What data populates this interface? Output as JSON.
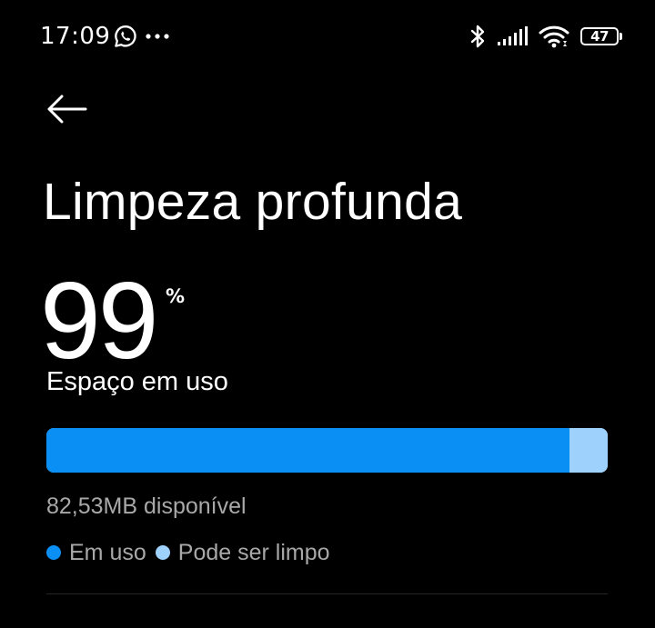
{
  "status_bar": {
    "time": "17:09",
    "notification_icons": [
      "whatsapp-icon",
      "more-dots-icon"
    ],
    "system_icons": [
      "bluetooth-icon",
      "signal-icon",
      "wifi-icon",
      "battery-icon"
    ],
    "battery_level": "47"
  },
  "header": {
    "back_icon": "back-arrow-icon",
    "title": "Limpeza profunda"
  },
  "usage": {
    "value": "99",
    "unit": "%",
    "label": "Espaço em uso",
    "used_fraction": 0.932,
    "available_text": "82,53MB disponível"
  },
  "legend": [
    {
      "label": "Em uso",
      "color": "#0a8ff5"
    },
    {
      "label": "Pode ser limpo",
      "color": "#9ed1fb"
    }
  ],
  "colors": {
    "background": "#000000",
    "used": "#0a8ff5",
    "cleanable": "#9ed1fb",
    "secondary_text": "#a8a8a8"
  }
}
